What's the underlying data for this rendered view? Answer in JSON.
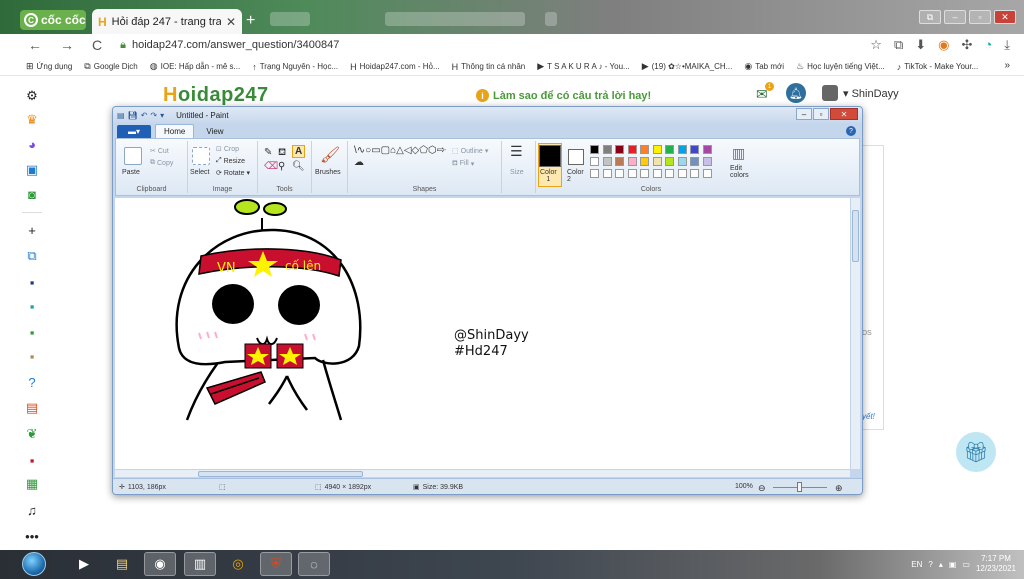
{
  "browser": {
    "brand": "cốc cốc",
    "active_tab_title": "Hỏi đáp 247 - trang tra lời",
    "new_tab_symbol": "+",
    "url": "hoidap247.com/answer_question/3400847",
    "nav": {
      "back": "←",
      "forward": "→",
      "reload": "C"
    },
    "window_buttons": [
      "⧉",
      "–",
      "▫",
      "✕"
    ]
  },
  "bookmarks": {
    "items": [
      {
        "icon": "apps-icon",
        "glyph": "⊞",
        "label": "Ứng dụng"
      },
      {
        "icon": "translate-icon",
        "glyph": "⧉",
        "label": "Google Dịch"
      },
      {
        "icon": "ioe-icon",
        "glyph": "◍",
        "label": "IOE: Hấp dẫn - mê s..."
      },
      {
        "icon": "trang-nguyen-icon",
        "glyph": "↑",
        "label": "Trạng Nguyên - Học..."
      },
      {
        "icon": "hoidap-icon",
        "glyph": "H",
        "label": "Hoidap247.com - Hỏ..."
      },
      {
        "icon": "hoidap-icon",
        "glyph": "H",
        "label": "Thông tin cá nhân"
      },
      {
        "icon": "youtube-icon",
        "glyph": "▶",
        "label": "T S A K U R A ♪ - You..."
      },
      {
        "icon": "youtube-icon",
        "glyph": "▶",
        "label": "(19) ✿☆•MAIKA_CH..."
      },
      {
        "icon": "globe-icon",
        "glyph": "◉",
        "label": "Tab mới"
      },
      {
        "icon": "learn-icon",
        "glyph": "♨",
        "label": "Học luyện tiếng Việt..."
      },
      {
        "icon": "tiktok-icon",
        "glyph": "♪",
        "label": "TikTok - Make Your..."
      }
    ],
    "more": "»"
  },
  "site": {
    "logo_prefix": "H",
    "logo_rest": "oidap247",
    "hint_text": "Làm sao để có câu trả lời hay!",
    "hint_icon": "i",
    "notification_count": "1",
    "username": "ShinDayy",
    "bg_label": "DS",
    "bg_link": "yết!"
  },
  "paint": {
    "title": "Untitled - Paint",
    "file_button": "▾",
    "tabs": [
      "Home",
      "View"
    ],
    "ribbon": {
      "clipboard": {
        "paste": "Paste",
        "cut": "Cut",
        "copy": "Copy",
        "label": "Clipboard"
      },
      "image": {
        "select": "Select",
        "crop": "Crop",
        "resize": "Resize",
        "rotate": "Rotate",
        "label": "Image"
      },
      "tools": {
        "label": "Tools"
      },
      "brushes": "Brushes",
      "shapes": {
        "outline": "Outline",
        "fill": "Fill",
        "label": "Shapes",
        "glyphs": "\\∿○▭▢⌂△◁◇⬠⬡⇨⇦⇧⇩✧☆✩▭◯◯☁"
      },
      "size": "Size",
      "color1": "Color\n1",
      "color2": "Color\n2",
      "colors_label": "Colors",
      "edit_colors": "Edit\ncolors"
    },
    "palette_row1": [
      "#000000",
      "#7f7f7f",
      "#880015",
      "#ed1c24",
      "#ff7f27",
      "#fff200",
      "#22b14c",
      "#00a2e8",
      "#3f48cc",
      "#a349a4"
    ],
    "palette_row2": [
      "#ffffff",
      "#c3c3c3",
      "#b97a57",
      "#ffaec9",
      "#ffc90e",
      "#efe4b0",
      "#b5e61d",
      "#99d9ea",
      "#7092be",
      "#c8bfe7"
    ],
    "color1_value": "#000000",
    "color2_value": "#ffffff",
    "canvas_text_line1": "@ShinDayy",
    "canvas_text_line2": "#Hd247",
    "headband_left": "VN",
    "headband_right": "cố lên",
    "status": {
      "cursor_pos": "1103, 186px",
      "image_size": "4940 × 1892px",
      "file_size": "Size: 39.9KB",
      "zoom": "100%"
    }
  },
  "taskbar": {
    "lang": "EN",
    "time": "7:17 PM",
    "date": "12/23/2021"
  }
}
